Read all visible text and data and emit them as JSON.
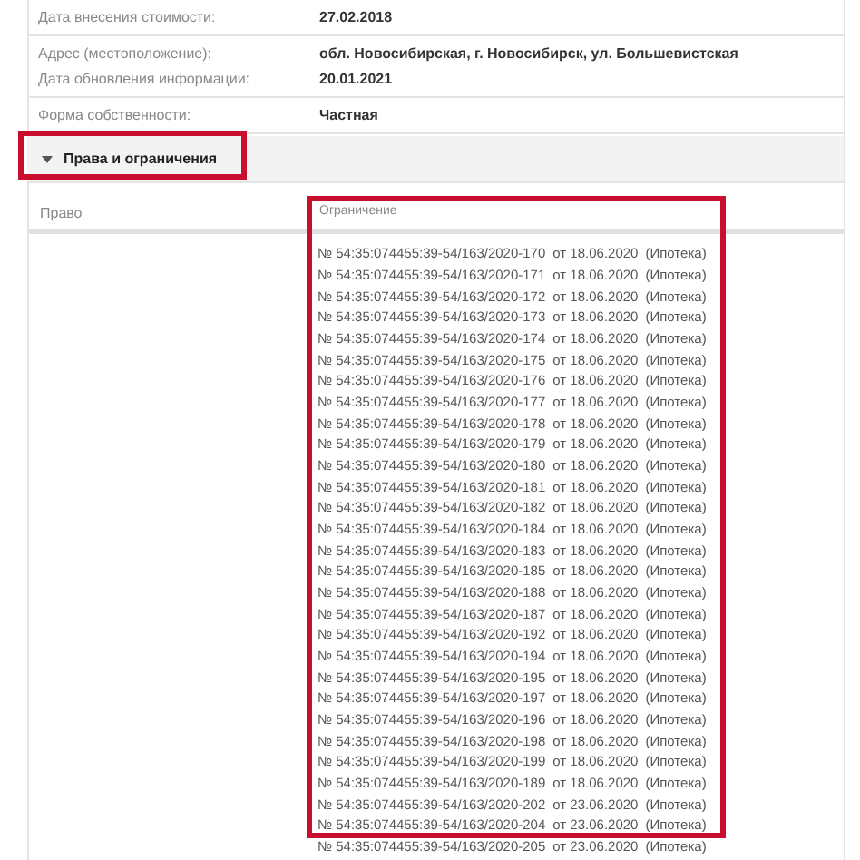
{
  "info_rows": [
    {
      "items": [
        {
          "label": "Дата внесения стоимости:",
          "value": "27.02.2018"
        }
      ]
    },
    {
      "items": [
        {
          "label": "Адрес (местоположение):",
          "value": "обл. Новосибирская, г. Новосибирск, ул. Большевистская"
        },
        {
          "label": "Дата обновления информации:",
          "value": "20.01.2021"
        }
      ]
    },
    {
      "items": [
        {
          "label": "Форма собственности:",
          "value": "Частная"
        }
      ]
    }
  ],
  "section": {
    "title": "Права и ограничения",
    "expanded": true
  },
  "table": {
    "columns": [
      "Право",
      "Ограничение"
    ],
    "rows": [
      {
        "number": "№ 54:35:074455:39-54/163/2020-170",
        "date": "от 18.06.2020",
        "type": "(Ипотека)"
      },
      {
        "number": "№ 54:35:074455:39-54/163/2020-171",
        "date": "от 18.06.2020",
        "type": "(Ипотека)"
      },
      {
        "number": "№ 54:35:074455:39-54/163/2020-172",
        "date": "от 18.06.2020",
        "type": "(Ипотека)"
      },
      {
        "number": "№ 54:35:074455:39-54/163/2020-173",
        "date": "от 18.06.2020",
        "type": "(Ипотека)"
      },
      {
        "number": "№ 54:35:074455:39-54/163/2020-174",
        "date": "от 18.06.2020",
        "type": "(Ипотека)"
      },
      {
        "number": "№ 54:35:074455:39-54/163/2020-175",
        "date": "от 18.06.2020",
        "type": "(Ипотека)"
      },
      {
        "number": "№ 54:35:074455:39-54/163/2020-176",
        "date": "от 18.06.2020",
        "type": "(Ипотека)"
      },
      {
        "number": "№ 54:35:074455:39-54/163/2020-177",
        "date": "от 18.06.2020",
        "type": "(Ипотека)"
      },
      {
        "number": "№ 54:35:074455:39-54/163/2020-178",
        "date": "от 18.06.2020",
        "type": "(Ипотека)"
      },
      {
        "number": "№ 54:35:074455:39-54/163/2020-179",
        "date": "от 18.06.2020",
        "type": "(Ипотека)"
      },
      {
        "number": "№ 54:35:074455:39-54/163/2020-180",
        "date": "от 18.06.2020",
        "type": "(Ипотека)"
      },
      {
        "number": "№ 54:35:074455:39-54/163/2020-181",
        "date": "от 18.06.2020",
        "type": "(Ипотека)"
      },
      {
        "number": "№ 54:35:074455:39-54/163/2020-182",
        "date": "от 18.06.2020",
        "type": "(Ипотека)"
      },
      {
        "number": "№ 54:35:074455:39-54/163/2020-184",
        "date": "от 18.06.2020",
        "type": "(Ипотека)"
      },
      {
        "number": "№ 54:35:074455:39-54/163/2020-183",
        "date": "от 18.06.2020",
        "type": "(Ипотека)"
      },
      {
        "number": "№ 54:35:074455:39-54/163/2020-185",
        "date": "от 18.06.2020",
        "type": "(Ипотека)"
      },
      {
        "number": "№ 54:35:074455:39-54/163/2020-188",
        "date": "от 18.06.2020",
        "type": "(Ипотека)"
      },
      {
        "number": "№ 54:35:074455:39-54/163/2020-187",
        "date": "от 18.06.2020",
        "type": "(Ипотека)"
      },
      {
        "number": "№ 54:35:074455:39-54/163/2020-192",
        "date": "от 18.06.2020",
        "type": "(Ипотека)"
      },
      {
        "number": "№ 54:35:074455:39-54/163/2020-194",
        "date": "от 18.06.2020",
        "type": "(Ипотека)"
      },
      {
        "number": "№ 54:35:074455:39-54/163/2020-195",
        "date": "от 18.06.2020",
        "type": "(Ипотека)"
      },
      {
        "number": "№ 54:35:074455:39-54/163/2020-197",
        "date": "от 18.06.2020",
        "type": "(Ипотека)"
      },
      {
        "number": "№ 54:35:074455:39-54/163/2020-196",
        "date": "от 18.06.2020",
        "type": "(Ипотека)"
      },
      {
        "number": "№ 54:35:074455:39-54/163/2020-198",
        "date": "от 18.06.2020",
        "type": "(Ипотека)"
      },
      {
        "number": "№ 54:35:074455:39-54/163/2020-199",
        "date": "от 18.06.2020",
        "type": "(Ипотека)"
      },
      {
        "number": "№ 54:35:074455:39-54/163/2020-189",
        "date": "от 18.06.2020",
        "type": "(Ипотека)"
      },
      {
        "number": "№ 54:35:074455:39-54/163/2020-202",
        "date": "от 23.06.2020",
        "type": "(Ипотека)"
      },
      {
        "number": "№ 54:35:074455:39-54/163/2020-204",
        "date": "от 23.06.2020",
        "type": "(Ипотека)"
      },
      {
        "number": "№ 54:35:074455:39-54/163/2020-205",
        "date": "от 23.06.2020",
        "type": "(Ипотека)"
      }
    ]
  }
}
